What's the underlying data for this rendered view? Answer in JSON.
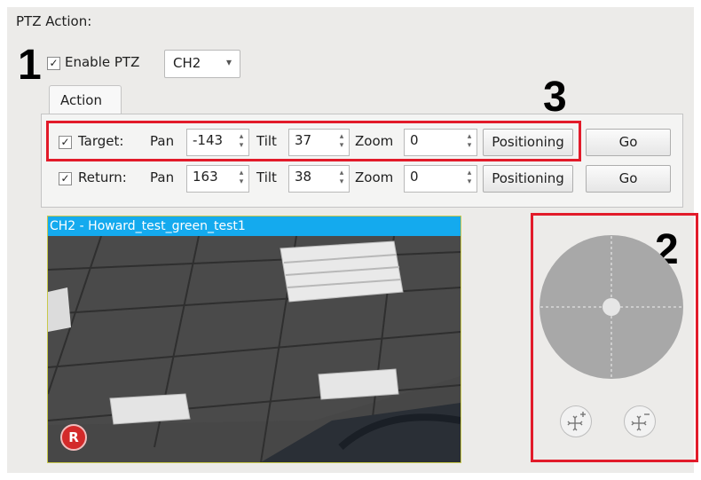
{
  "header": {
    "title": "PTZ Action:"
  },
  "enable_ptz": {
    "checked_mark": "✓",
    "label": "Enable PTZ",
    "channel": "CH2",
    "chevron": "▾"
  },
  "tabs": [
    {
      "label": "Action"
    }
  ],
  "rows": [
    {
      "checked_mark": "✓",
      "label": "Target:",
      "pan_label": "Pan",
      "pan": "-143",
      "tilt_label": "Tilt",
      "tilt": "37",
      "zoom_label": "Zoom",
      "zoom": "0",
      "positioning": "Positioning",
      "go": "Go"
    },
    {
      "checked_mark": "✓",
      "label": "Return:",
      "pan_label": "Pan",
      "pan": "163",
      "tilt_label": "Tilt",
      "tilt": "38",
      "zoom_label": "Zoom",
      "zoom": "0",
      "positioning": "Positioning",
      "go": "Go"
    }
  ],
  "spin_arrows": "▴\n▾",
  "video": {
    "title": "CH2 - Howard_test_green_test1",
    "record_badge": "R"
  },
  "annotations": {
    "one": "1",
    "two": "2",
    "three": "3"
  },
  "colors": {
    "highlight_box": "#e21b2a",
    "video_title_bar": "#14aaee",
    "joystick": "#a8a8a8"
  },
  "icons": {
    "zoom_in": "move-plus-icon",
    "zoom_out": "move-minus-icon",
    "joystick": "joystick-pad-icon",
    "record": "record-badge-icon"
  }
}
